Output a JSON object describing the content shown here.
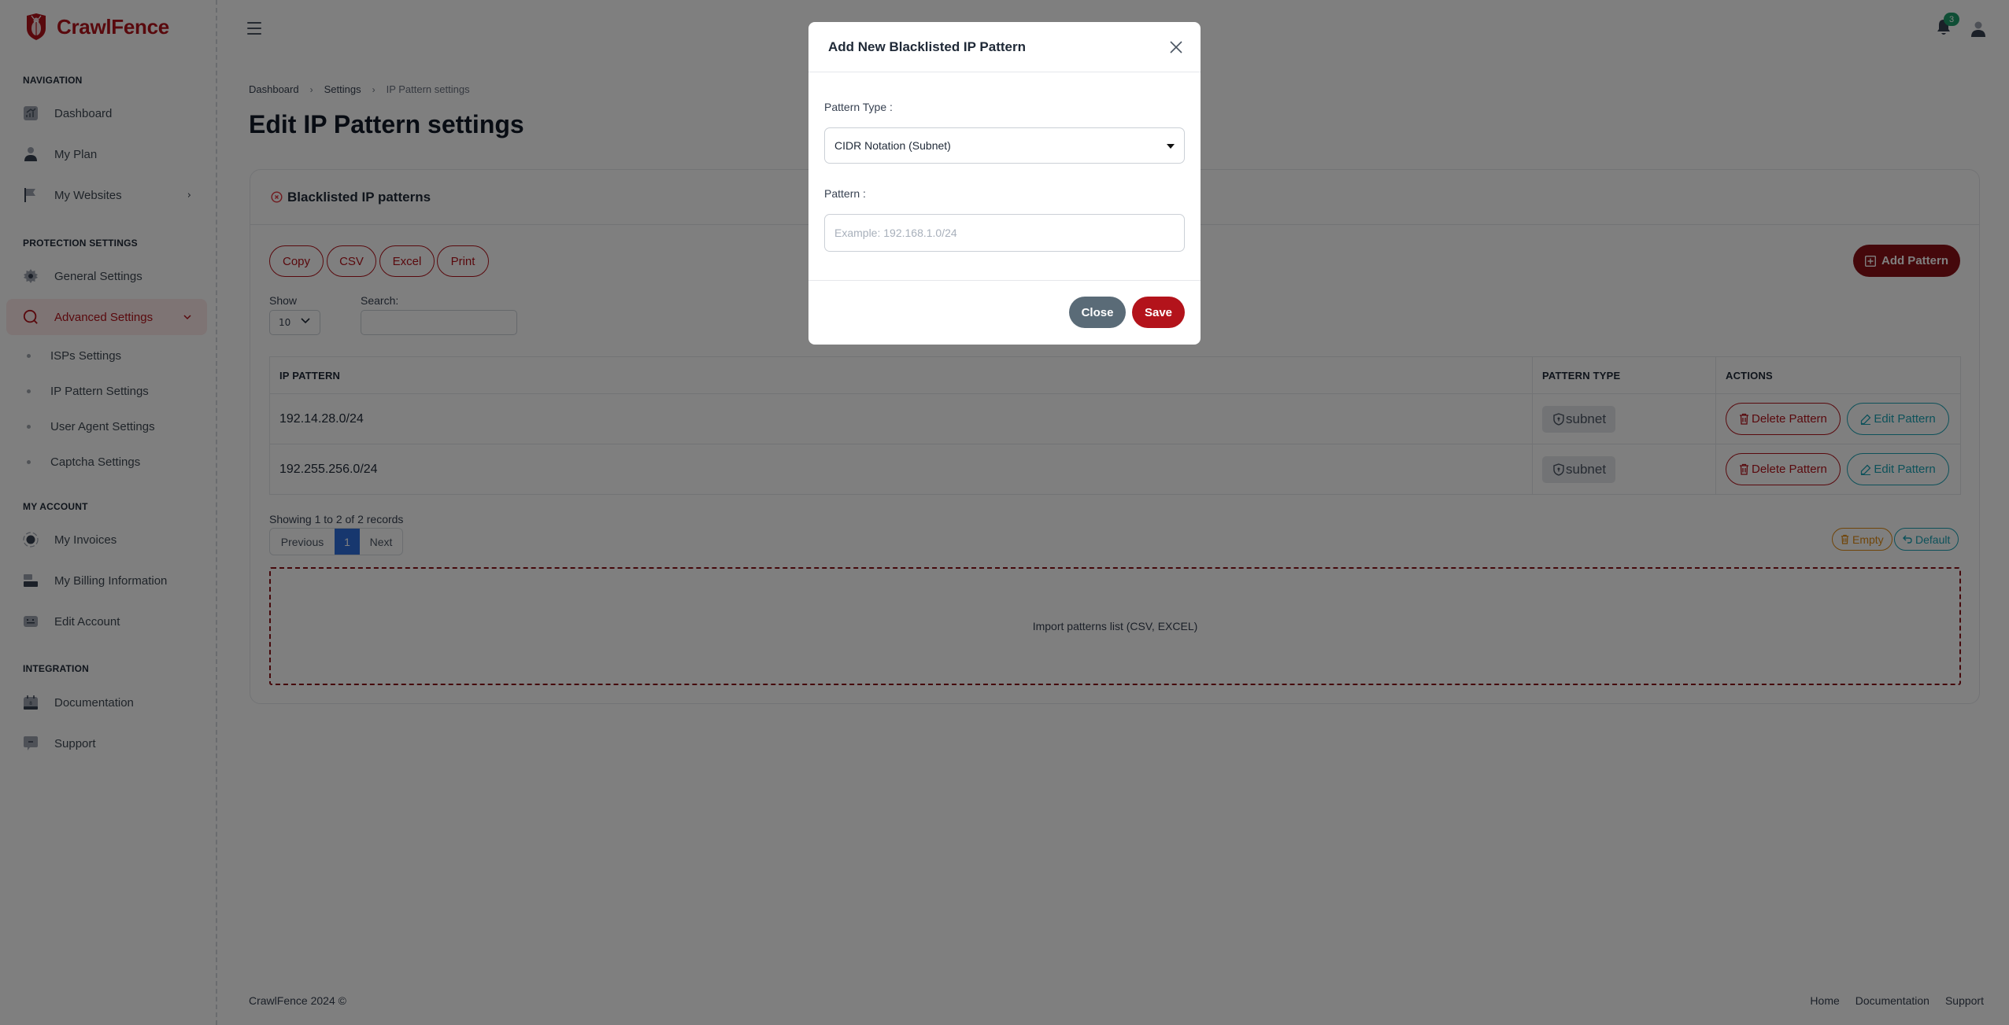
{
  "brand": {
    "name": "CrawlFence",
    "accent": "#b3131b"
  },
  "sidebar": {
    "sections": [
      {
        "title": "NAVIGATION"
      },
      {
        "title": "PROTECTION SETTINGS"
      },
      {
        "title": "MY ACCOUNT"
      },
      {
        "title": "INTEGRATION"
      }
    ],
    "items": [
      {
        "label": "Dashboard",
        "icon": "chart-icon"
      },
      {
        "label": "My Plan",
        "icon": "user-icon"
      },
      {
        "label": "My Websites",
        "icon": "flag-icon",
        "chevron": "›"
      },
      {
        "label": "General Settings",
        "icon": "gear-icon"
      },
      {
        "label": "Advanced Settings",
        "icon": "search-icon",
        "chevron": "⌄",
        "active": true
      },
      {
        "label": "My Invoices",
        "icon": "record-icon"
      },
      {
        "label": "My Billing Information",
        "icon": "billing-icon"
      },
      {
        "label": "Edit Account",
        "icon": "keyboard-icon"
      },
      {
        "label": "Documentation",
        "icon": "calendar-icon"
      },
      {
        "label": "Support",
        "icon": "chat-icon"
      }
    ],
    "subitems": [
      {
        "label": "ISPs Settings"
      },
      {
        "label": "IP Pattern Settings"
      },
      {
        "label": "User Agent Settings"
      },
      {
        "label": "Captcha Settings"
      }
    ]
  },
  "topbar": {
    "notification_count": "3"
  },
  "breadcrumb": {
    "items": [
      "Dashboard",
      "Settings",
      "IP Pattern settings"
    ],
    "separator": "›"
  },
  "page": {
    "title": "Edit IP Pattern settings"
  },
  "card": {
    "title": "Blacklisted IP patterns",
    "export_buttons": [
      "Copy",
      "CSV",
      "Excel",
      "Print"
    ],
    "add_button": "Add Pattern",
    "show_label": "Show",
    "show_value": "10",
    "search_label": "Search:",
    "search_value": "",
    "table": {
      "headers": [
        "IP PATTERN",
        "PATTERN TYPE",
        "ACTIONS"
      ],
      "rows": [
        {
          "pattern": "192.14.28.0/24",
          "type": "subnet",
          "delete": "Delete Pattern",
          "edit": "Edit Pattern"
        },
        {
          "pattern": "192.255.256.0/24",
          "type": "subnet",
          "delete": "Delete Pattern",
          "edit": "Edit Pattern"
        }
      ]
    },
    "records_text": "Showing 1 to 2 of 2 records",
    "pagination": {
      "previous": "Previous",
      "current": "1",
      "next": "Next"
    },
    "empty_button": "Empty",
    "default_button": "Default",
    "dropzone_text": "Import patterns list (CSV, EXCEL)"
  },
  "footer": {
    "copyright": "CrawlFence 2024 ©",
    "links": [
      "Home",
      "Documentation",
      "Support"
    ]
  },
  "modal": {
    "title": "Add New Blacklisted IP Pattern",
    "pattern_type_label": "Pattern Type :",
    "pattern_type_value": "CIDR Notation (Subnet)",
    "pattern_label": "Pattern :",
    "pattern_value": "",
    "pattern_placeholder": "Example: 192.168.1.0/24",
    "close_button": "Close",
    "save_button": "Save"
  }
}
